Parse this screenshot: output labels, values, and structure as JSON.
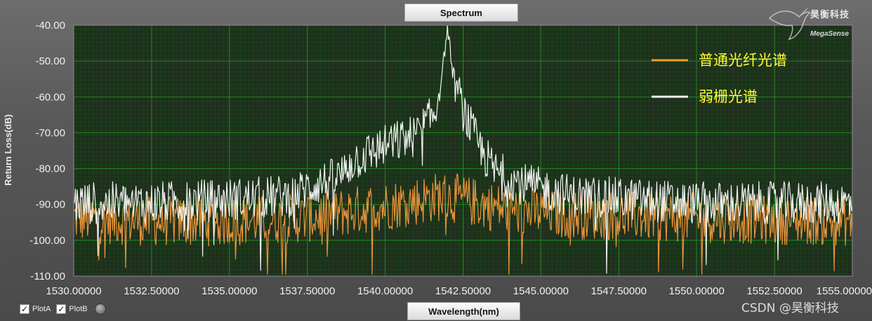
{
  "window": {
    "title": "Spectrum",
    "x_axis_title": "Wavelength(nm)"
  },
  "controls": {
    "plots": [
      {
        "label": "PlotA",
        "checked": true
      },
      {
        "label": "PlotB",
        "checked": true
      }
    ],
    "cursor_tool_icon": "cursor-ball-icon"
  },
  "branding": {
    "logo_cn": "昊衡科技",
    "logo_en": "MegaSense",
    "watermark": "CSDN @昊衡科技",
    "logo_icon": "hummingbird-icon"
  },
  "colors": {
    "plot_bg": "#1f2f1d",
    "grid_major": "#1f8a1f",
    "grid_minor": "#174d17",
    "series_orange": "#e8943a",
    "series_white": "#f2f2f2",
    "legend_text": "#ffff33",
    "legend_line_orange": "#e8a020"
  },
  "chart_data": {
    "type": "line",
    "title": "Spectrum",
    "xlabel": "Wavelength(nm)",
    "ylabel": "Return Loss(dB)",
    "xlim": [
      1530.0,
      1555.0
    ],
    "ylim": [
      -110.0,
      -40.0
    ],
    "x_ticks": [
      "1530.00000",
      "1532.50000",
      "1535.00000",
      "1537.50000",
      "1540.00000",
      "1542.50000",
      "1545.00000",
      "1547.50000",
      "1550.00000",
      "1552.50000",
      "1555.00000"
    ],
    "y_ticks": [
      "-40.00",
      "-50.00",
      "-60.00",
      "-70.00",
      "-80.00",
      "-90.00",
      "-100.00",
      "-110.00"
    ],
    "grid": true,
    "legend_position": "top-right",
    "series": [
      {
        "name": "普通光纤光谱",
        "color": "#e8943a",
        "envelope": [
          [
            1530.0,
            -93
          ],
          [
            1532.5,
            -94
          ],
          [
            1535.0,
            -94
          ],
          [
            1537.5,
            -93
          ],
          [
            1539.0,
            -91
          ],
          [
            1540.5,
            -89
          ],
          [
            1541.8,
            -87
          ],
          [
            1542.5,
            -88
          ],
          [
            1544.0,
            -91
          ],
          [
            1546.0,
            -92
          ],
          [
            1550.0,
            -93
          ],
          [
            1555.0,
            -94
          ]
        ],
        "noise_db": 7
      },
      {
        "name": "弱栅光谱",
        "color": "#f2f2f2",
        "envelope": [
          [
            1530.0,
            -89
          ],
          [
            1532.5,
            -89
          ],
          [
            1535.0,
            -88
          ],
          [
            1537.0,
            -87
          ],
          [
            1537.7,
            -84
          ],
          [
            1538.5,
            -82
          ],
          [
            1539.0,
            -77
          ],
          [
            1540.0,
            -73
          ],
          [
            1541.0,
            -70
          ],
          [
            1541.6,
            -64
          ],
          [
            1541.85,
            -52
          ],
          [
            1542.0,
            -40
          ],
          [
            1542.15,
            -52
          ],
          [
            1542.5,
            -63
          ],
          [
            1543.0,
            -73
          ],
          [
            1543.5,
            -80
          ],
          [
            1544.5,
            -84
          ],
          [
            1546.0,
            -87
          ],
          [
            1550.0,
            -89
          ],
          [
            1555.0,
            -89
          ]
        ],
        "noise_db": 6
      }
    ]
  }
}
